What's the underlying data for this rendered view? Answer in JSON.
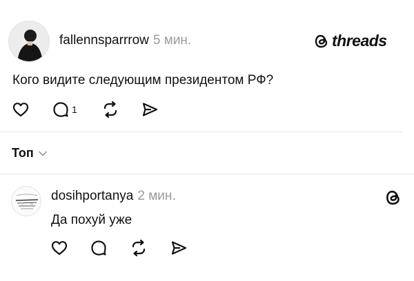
{
  "post": {
    "username": "fallennsparrrow",
    "time": "5 мин.",
    "text": "Кого видите следующим президентом РФ?",
    "reply_count": "1"
  },
  "brand": {
    "logo_text": "threads"
  },
  "sort": {
    "label": "Топ"
  },
  "comment": {
    "username": "dosihportanya",
    "time": "2 мин.",
    "text": "Да похуй уже"
  },
  "icons": [
    "threads-logo-icon",
    "heart-icon",
    "comment-icon",
    "repost-icon",
    "share-icon",
    "chevron-down-icon"
  ]
}
